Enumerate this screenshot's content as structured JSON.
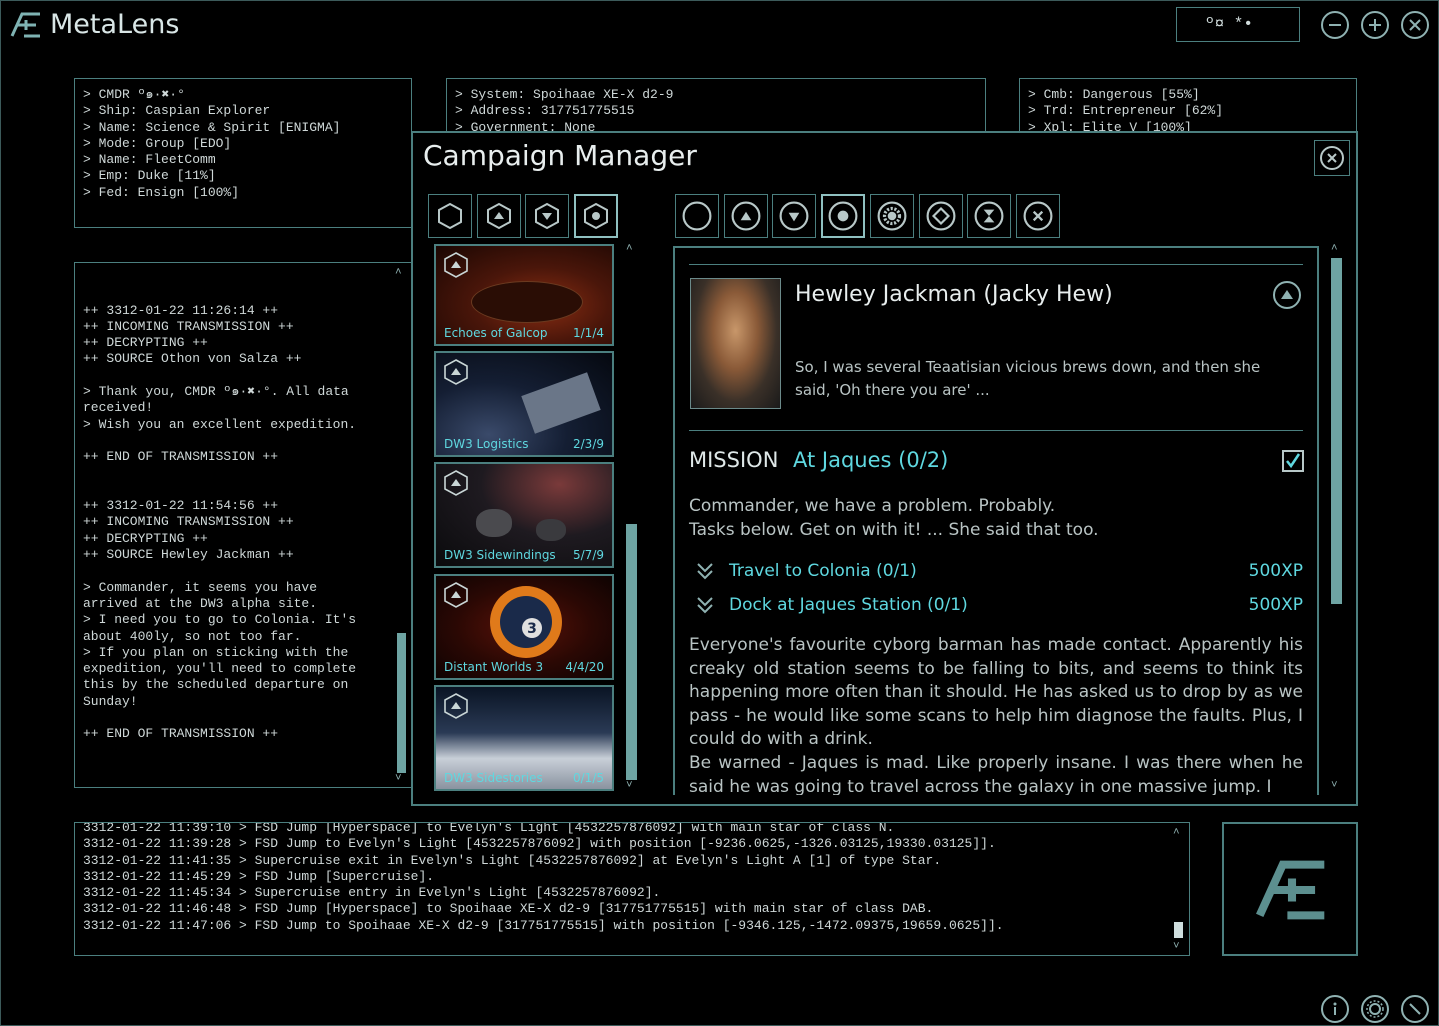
{
  "app": {
    "title": "MetaLens",
    "cmdr_glyphs": "º¤ *•"
  },
  "left_info": [
    "> CMDR º๑·✖·°",
    "> Ship: Caspian Explorer",
    "> Name: Science & Spirit [ENIGMA]",
    "> Mode: Group [EDO]",
    "> Name: FleetComm",
    "> Emp: Duke [11%]",
    "> Fed: Ensign [100%]"
  ],
  "mid_info": [
    "> System: Spoihaae XE-X d2-9",
    "> Address: 317751775515",
    "> Government: None"
  ],
  "right_info": [
    "> Cmb: Dangerous [55%]",
    "> Trd: Entrepreneur [62%]",
    "> Xpl: Elite V [100%]"
  ],
  "transmissions": [
    "",
    "",
    "++ 3312-01-22 11:26:14 ++",
    "++ INCOMING TRANSMISSION ++",
    "++ DECRYPTING ++",
    "++ SOURCE Othon von Salza ++",
    "",
    "> Thank you, CMDR º๑·✖·°. All data",
    "received!",
    "> Wish you an excellent expedition.",
    "",
    "++ END OF TRANSMISSION ++",
    "",
    "",
    "++ 3312-01-22 11:54:56 ++",
    "++ INCOMING TRANSMISSION ++",
    "++ DECRYPTING ++",
    "++ SOURCE Hewley Jackman ++",
    "",
    "> Commander, it seems you have",
    "arrived at the DW3 alpha site.",
    "> I need you to go to Colonia. It's",
    "about 400ly, so not too far.",
    "> If you plan on sticking with the",
    "expedition, you'll need to complete",
    "this by the scheduled departure on",
    "Sunday!",
    "",
    "++ END OF TRANSMISSION ++"
  ],
  "log_lines": [
    "3312-01-22 11:39:10 > FSD Jump [Hyperspace] to Evelyn's Light [4532257876092] with main star of class N.",
    "3312-01-22 11:39:28 > FSD Jump to Evelyn's Light [4532257876092] with position [-9236.0625,-1326.03125,19330.03125]].",
    "3312-01-22 11:41:35 > Supercruise exit in Evelyn's Light [4532257876092] at Evelyn's Light A [1] of type Star.",
    "3312-01-22 11:45:29 > FSD Jump [Supercruise].",
    "3312-01-22 11:45:34 > Supercruise entry in Evelyn's Light [4532257876092].",
    "3312-01-22 11:46:48 > FSD Jump [Hyperspace] to Spoihaae XE-X d2-9 [317751775515] with main star of class DAB.",
    "3312-01-22 11:47:06 > FSD Jump to Spoihaae XE-X d2-9 [317751775515] with position [-9346.125,-1472.09375,19659.0625]]."
  ],
  "campaign": {
    "title": "Campaign Manager",
    "campaigns": [
      {
        "name": "Echoes of Galcop",
        "count": "1/1/4"
      },
      {
        "name": "DW3 Logistics",
        "count": "2/3/9"
      },
      {
        "name": "DW3 Sidewindings",
        "count": "5/7/9"
      },
      {
        "name": "Distant Worlds 3",
        "count": "4/4/20"
      },
      {
        "name": "DW3 Sidestories",
        "count": "0/1/5"
      }
    ],
    "character": {
      "name": "Hewley Jackman (Jacky Hew)",
      "quote": "So, I was several Teaatisian vicious brews down, and then she said, 'Oh there you are' ..."
    },
    "mission": {
      "label": "MISSION",
      "title": "At Jaques (0/2)",
      "intro1": "Commander, we have a problem. Probably.",
      "intro2": "Tasks below. Get on with it! ... She said that too.",
      "tasks": [
        {
          "name": "Travel to Colonia (0/1)",
          "xp": "500XP"
        },
        {
          "name": "Dock at Jaques Station (0/1)",
          "xp": "500XP"
        }
      ],
      "body1": "Everyone's favourite cyborg barman has made contact. Apparently his creaky old station seems to be falling to bits, and seems to think its happening more often than it should. He has asked us to drop by as we pass - he would like some scans to help him diagnose the faults. Plus, I could do with a drink.",
      "body2": "Be warned - Jaques is mad. Like properly insane. I was there when he said he was going to travel across the galaxy in one massive jump. I"
    },
    "filter_icons": [
      "hexagon-icon",
      "hex-up-icon",
      "hex-down-icon",
      "hex-star-icon"
    ],
    "status_icons": [
      "empty-circle-icon",
      "up-circle-icon",
      "down-circle-icon",
      "star-circle-icon",
      "burst-circle-icon",
      "diamond-circle-icon",
      "hourglass-circle-icon",
      "x-circle-icon"
    ]
  },
  "colors": {
    "accent": "#5fd8e0",
    "border": "#4b7f7f",
    "scroll": "#6ea4a3"
  }
}
